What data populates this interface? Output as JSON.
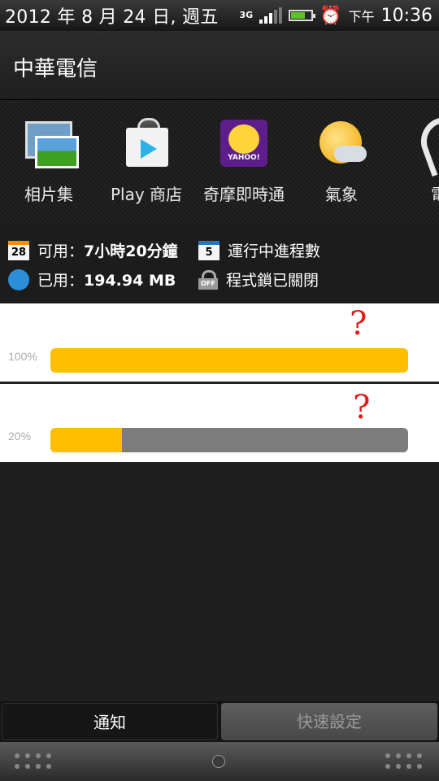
{
  "status_bar": {
    "date": "2012 年 8 月 24 日, 週五",
    "network": "3G",
    "ampm": "下午",
    "time": "10:36"
  },
  "carrier": {
    "name": "中華電信"
  },
  "apps": [
    {
      "label": "相片集",
      "icon": "gallery-icon"
    },
    {
      "label": "Play 商店",
      "icon": "play-store-icon"
    },
    {
      "label": "奇摩即時通",
      "icon": "yahoo-messenger-icon"
    },
    {
      "label": "氣象",
      "icon": "weather-icon"
    },
    {
      "label": "電",
      "icon": "phone-icon"
    }
  ],
  "stats": {
    "available_prefix": "可用：",
    "available_value": "7小時20分鐘",
    "available_badge": "28",
    "running_label": "運行中進程數",
    "running_badge": "5",
    "used_prefix": "已用：",
    "used_value": "194.94 MB",
    "lock_label": "程式鎖已關閉",
    "lock_badge": "OFF"
  },
  "cards": [
    {
      "percent_label": "100%",
      "level": 1.0,
      "annotation": "?"
    },
    {
      "percent_label": "20%",
      "level": 0.2,
      "annotation": "?"
    }
  ],
  "tabs": {
    "notifications": "通知",
    "quick_settings": "快速設定"
  },
  "colors": {
    "bar_fill": "#ffbe00",
    "bar_track": "#7c7c7c",
    "annotation": "#e21b1b"
  }
}
